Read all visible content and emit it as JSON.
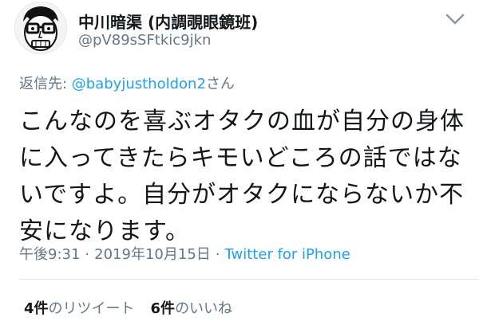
{
  "author": {
    "display_name": "中川暗渠 (内調覗眼鏡班)",
    "handle": "@pV89sSFtkic9jkn"
  },
  "reply": {
    "label": "返信先: ",
    "handle": "@babyjustholdon2",
    "suffix": "さん"
  },
  "tweet": {
    "line1": "こんなのを喜ぶオタクの血が自分の身体",
    "line2": "に入ってきたらキモいどころの話ではな",
    "line3": "いですよ。自分がオタクにならないか不",
    "line4": "安になります。"
  },
  "meta": {
    "time": "午後9:31",
    "separator": "·",
    "date": "2019年10月15日",
    "source": "Twitter for iPhone"
  },
  "stats": {
    "retweet_count": "4件",
    "retweet_label": "のリツイート",
    "like_count": "6件",
    "like_label": "のいいね"
  },
  "icons": {
    "menu": "chevron-down-icon",
    "avatar": "cartoon-face-avatar"
  },
  "colors": {
    "link": "#1da1f2",
    "secondary_text": "#657786",
    "primary_text": "#14171a",
    "divider": "#e1e8ed"
  }
}
